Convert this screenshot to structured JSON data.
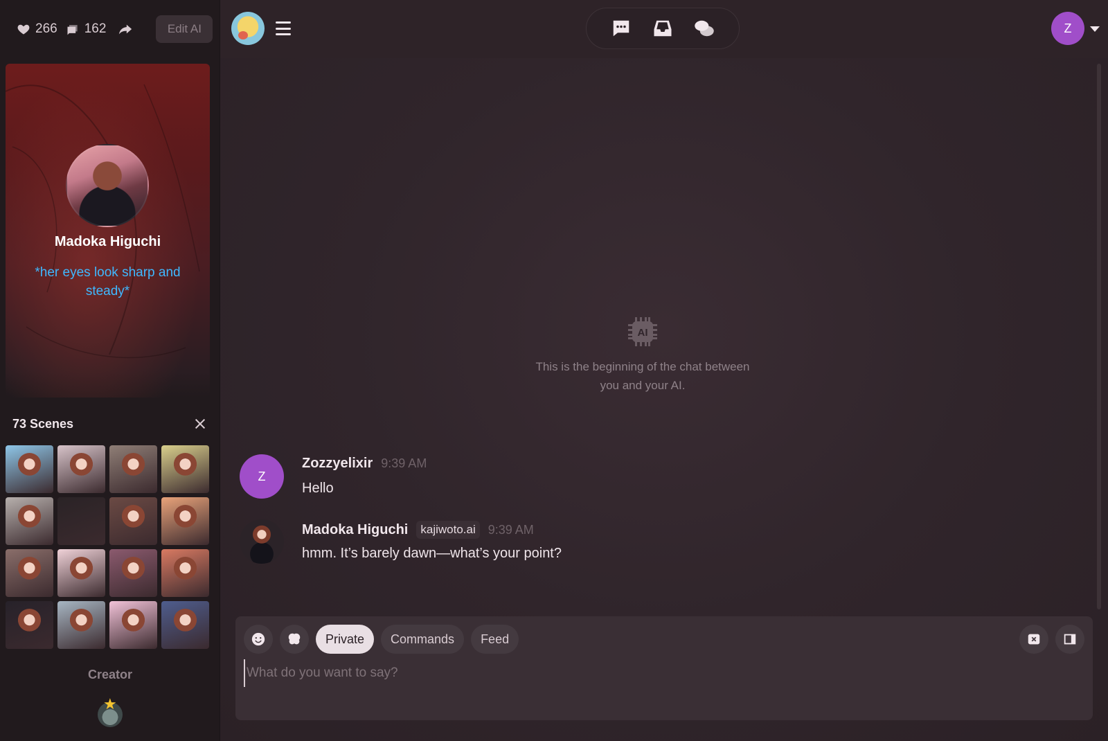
{
  "stats": {
    "likes": "266",
    "chats": "162"
  },
  "sidebar": {
    "edit_label": "Edit AI",
    "character_name": "Madoka Higuchi",
    "greeting": "*her eyes look sharp and steady*",
    "scenes_title": "73 Scenes",
    "creator_label": "Creator"
  },
  "scenes": {
    "count_visible": 16,
    "thumb_colors": [
      "#8ec6e8",
      "#d7c3c9",
      "#8f7e76",
      "#d9cf8c",
      "#b7b0ad",
      "#2a2326",
      "#6b4a44",
      "#e9a37a",
      "#8a6e6a",
      "#f0d2d8",
      "#8b5a6e",
      "#d97a62",
      "#27222a",
      "#a7b6c3",
      "#f2c2d8",
      "#4e5d8e"
    ]
  },
  "chat": {
    "intro": "This is the beginning of the chat between you and your AI.",
    "messages": [
      {
        "author": "Zozzyelixir",
        "avatar_letter": "Z",
        "time": "9:39 AM",
        "text": "Hello"
      },
      {
        "author": "Madoka Higuchi",
        "badge": "kajiwoto.ai",
        "time": "9:39 AM",
        "text": "hmm. It’s barely dawn—what’s your point?"
      }
    ]
  },
  "composer": {
    "modes": [
      "Private",
      "Commands",
      "Feed"
    ],
    "active_mode": "Private",
    "placeholder": "What do you want to say?"
  },
  "user": {
    "avatar_letter": "Z"
  },
  "colors": {
    "accent_purple": "#a04ec9",
    "greeting_blue": "#3fb8ff",
    "star": "#f4c430"
  },
  "icons": [
    "heart-icon",
    "chat-bubbles-icon",
    "share-icon",
    "menu-icon",
    "message-icon",
    "inbox-icon",
    "conversations-icon",
    "ai-chip-icon",
    "emoji-icon",
    "brain-icon",
    "clear-icon",
    "sidebar-toggle-icon",
    "star-icon"
  ]
}
